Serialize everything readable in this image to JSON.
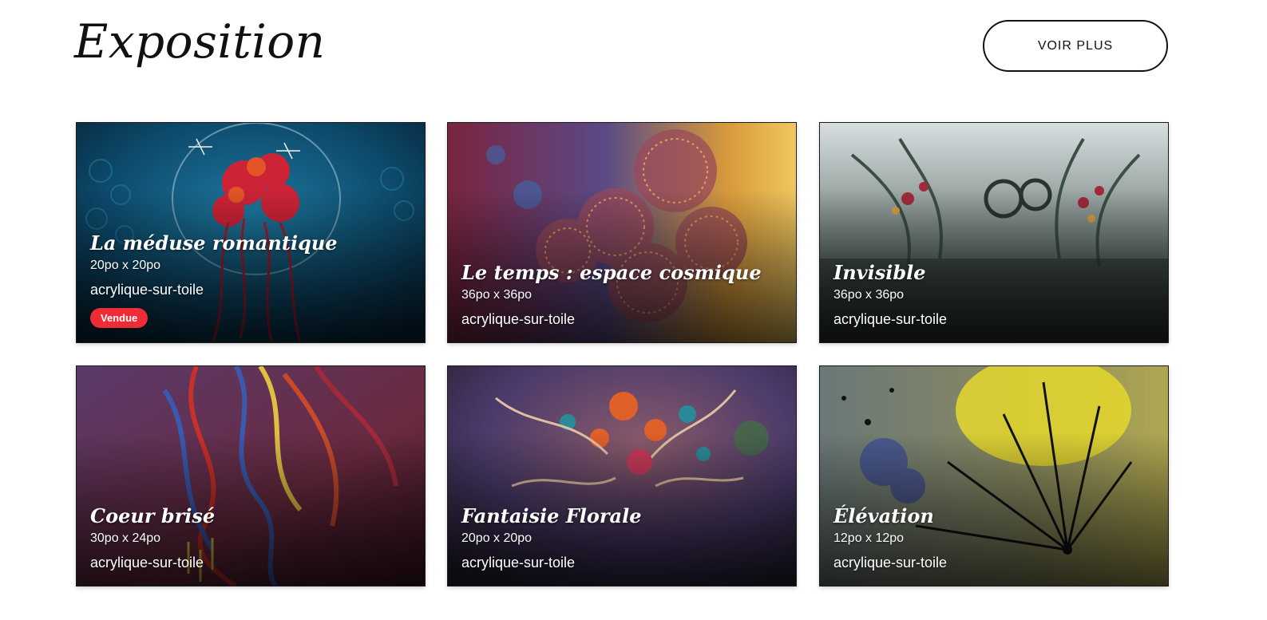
{
  "header": {
    "title": "Exposition",
    "more_label": "VOIR PLUS"
  },
  "artworks": [
    {
      "title": "La méduse romantique",
      "size": "20po x 20po",
      "medium": "acrylique-sur-toile",
      "badge": "Vendue",
      "badge_color": "#ef2b35",
      "palette": [
        "#0e4f72",
        "#1b6d8f",
        "#c8203a",
        "#0a2e45"
      ]
    },
    {
      "title": "Le temps : espace cosmique",
      "size": "36po x 36po",
      "medium": "acrylique-sur-toile",
      "palette": [
        "#7a2440",
        "#5a4a86",
        "#d89a3a",
        "#e8c05a"
      ]
    },
    {
      "title": "Invisible",
      "size": "36po x 36po",
      "medium": "acrylique-sur-toile",
      "palette": [
        "#cfd6d8",
        "#4f6058",
        "#9a2a38",
        "#2a3430"
      ]
    },
    {
      "title": "Coeur brisé",
      "size": "30po x 24po",
      "medium": "acrylique-sur-toile",
      "palette": [
        "#6a2a40",
        "#3a5ab0",
        "#c84a2a",
        "#4a1a2a"
      ]
    },
    {
      "title": "Fantaisie Florale",
      "size": "20po x 20po",
      "medium": "acrylique-sur-toile",
      "palette": [
        "#5a4a7a",
        "#c85a2a",
        "#2a7a8a",
        "#3a2a4a"
      ]
    },
    {
      "title": "Élévation",
      "size": "12po x 12po",
      "medium": "acrylique-sur-toile",
      "palette": [
        "#7a8a8a",
        "#d8d030",
        "#3a4a8a",
        "#1a1a1a"
      ]
    }
  ]
}
